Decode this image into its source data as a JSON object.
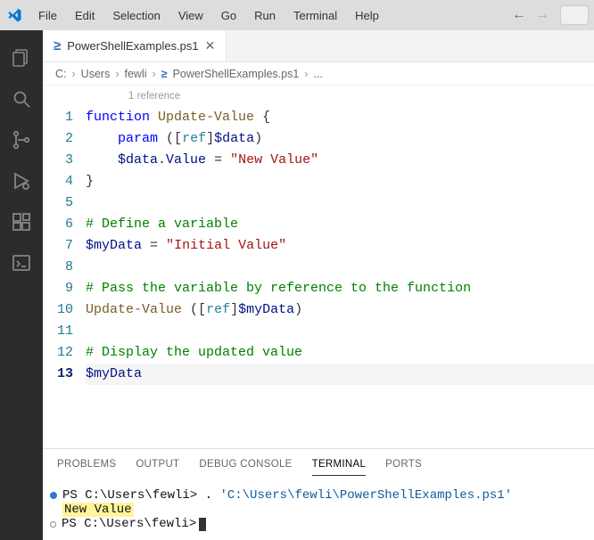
{
  "menubar": {
    "items": [
      "File",
      "Edit",
      "Selection",
      "View",
      "Go",
      "Run",
      "Terminal",
      "Help"
    ]
  },
  "tab": {
    "filename": "PowerShellExamples.ps1"
  },
  "breadcrumbs": {
    "parts": [
      "C:",
      "Users",
      "fewli"
    ],
    "file": "PowerShellExamples.ps1",
    "trailing": "..."
  },
  "codelens": "1 reference",
  "code": {
    "lines": [
      {
        "n": 1,
        "tokens": [
          [
            "kw",
            "function"
          ],
          [
            "sp",
            " "
          ],
          [
            "fn",
            "Update-Value"
          ],
          [
            "sp",
            " "
          ],
          [
            "punc",
            "{"
          ]
        ]
      },
      {
        "n": 2,
        "tokens": [
          [
            "sp",
            "    "
          ],
          [
            "kw",
            "param"
          ],
          [
            "sp",
            " "
          ],
          [
            "punc",
            "(["
          ],
          [
            "type",
            "ref"
          ],
          [
            "punc",
            "]"
          ],
          [
            "var",
            "$data"
          ],
          [
            "punc",
            ")"
          ]
        ]
      },
      {
        "n": 3,
        "tokens": [
          [
            "sp",
            "    "
          ],
          [
            "var",
            "$data"
          ],
          [
            "punc",
            "."
          ],
          [
            "prop",
            "Value"
          ],
          [
            "sp",
            " "
          ],
          [
            "op",
            "="
          ],
          [
            "sp",
            " "
          ],
          [
            "str",
            "\"New Value\""
          ]
        ]
      },
      {
        "n": 4,
        "tokens": [
          [
            "punc",
            "}"
          ]
        ]
      },
      {
        "n": 5,
        "tokens": []
      },
      {
        "n": 6,
        "tokens": [
          [
            "cmt",
            "# Define a variable"
          ]
        ]
      },
      {
        "n": 7,
        "tokens": [
          [
            "var",
            "$myData"
          ],
          [
            "sp",
            " "
          ],
          [
            "op",
            "="
          ],
          [
            "sp",
            " "
          ],
          [
            "str",
            "\"Initial Value\""
          ]
        ]
      },
      {
        "n": 8,
        "tokens": []
      },
      {
        "n": 9,
        "tokens": [
          [
            "cmt",
            "# Pass the variable by reference to the function"
          ]
        ]
      },
      {
        "n": 10,
        "tokens": [
          [
            "fn",
            "Update-Value"
          ],
          [
            "sp",
            " "
          ],
          [
            "punc",
            "(["
          ],
          [
            "type",
            "ref"
          ],
          [
            "punc",
            "]"
          ],
          [
            "var",
            "$myData"
          ],
          [
            "punc",
            ")"
          ]
        ]
      },
      {
        "n": 11,
        "tokens": []
      },
      {
        "n": 12,
        "tokens": [
          [
            "cmt",
            "# Display the updated value"
          ]
        ]
      },
      {
        "n": 13,
        "tokens": [
          [
            "var",
            "$myData"
          ]
        ],
        "current": true
      }
    ]
  },
  "panel": {
    "tabs": [
      "PROBLEMS",
      "OUTPUT",
      "DEBUG CONSOLE",
      "TERMINAL",
      "PORTS"
    ],
    "active": "TERMINAL"
  },
  "terminal": {
    "line1_prompt": "PS C:\\Users\\fewli>",
    "line1_cmd_dot": ".",
    "line1_cmd_path": "'C:\\Users\\fewli\\PowerShellExamples.ps1'",
    "line2_output": "New Value",
    "line3_prompt": "PS C:\\Users\\fewli>"
  }
}
